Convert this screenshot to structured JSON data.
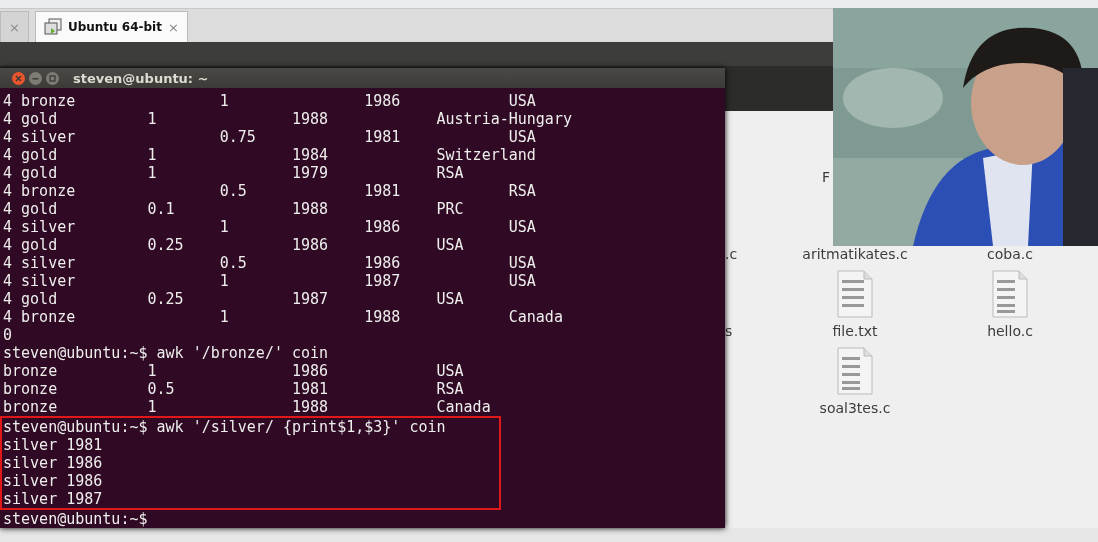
{
  "tabs": [
    {
      "close": "×",
      "selected": false
    },
    {
      "label": "Ubuntu 64-bit",
      "close": "×",
      "selected": true
    }
  ],
  "terminal": {
    "title": "steven@ubuntu: ~",
    "lines": [
      {
        "text": "4 bronze\t\t1\t\t1986\t\tUSA",
        "highlighted": false
      },
      {
        "text": "4 gold\t\t1\t\t1988\t\tAustria-Hungary",
        "highlighted": false
      },
      {
        "text": "4 silver\t\t0.75\t\t1981\t\tUSA",
        "highlighted": false
      },
      {
        "text": "4 gold\t\t1\t\t1984\t\tSwitzerland",
        "highlighted": false
      },
      {
        "text": "4 gold\t\t1\t\t1979\t\tRSA",
        "highlighted": false
      },
      {
        "text": "4 bronze\t\t0.5\t\t1981\t\tRSA",
        "highlighted": false
      },
      {
        "text": "4 gold\t\t0.1\t\t1988\t\tPRC",
        "highlighted": false
      },
      {
        "text": "4 silver\t\t1\t\t1986\t\tUSA",
        "highlighted": false
      },
      {
        "text": "4 gold\t\t0.25\t\t1986\t\tUSA",
        "highlighted": false
      },
      {
        "text": "4 silver\t\t0.5\t\t1986\t\tUSA",
        "highlighted": false
      },
      {
        "text": "4 silver\t\t1\t\t1987\t\tUSA",
        "highlighted": false
      },
      {
        "text": "4 gold\t\t0.25\t\t1987\t\tUSA",
        "highlighted": false
      },
      {
        "text": "4 bronze\t\t1\t\t1988\t\tCanada",
        "highlighted": false
      },
      {
        "text": "0",
        "highlighted": false
      },
      {
        "text": "steven@ubuntu:~$ awk '/bronze/' coin",
        "highlighted": false
      },
      {
        "text": "bronze\t\t1\t\t1986\t\tUSA",
        "highlighted": false
      },
      {
        "text": "bronze\t\t0.5\t\t1981\t\tRSA",
        "highlighted": false
      },
      {
        "text": "bronze\t\t1\t\t1988\t\tCanada",
        "highlighted": false
      },
      {
        "text": "steven@ubuntu:~$ awk '/silver/ {print$1,$3}' coin",
        "highlighted": true
      },
      {
        "text": "silver 1981",
        "highlighted": true
      },
      {
        "text": "silver 1986",
        "highlighted": true
      },
      {
        "text": "silver 1986",
        "highlighted": true
      },
      {
        "text": "silver 1987",
        "highlighted": true
      },
      {
        "text": "steven@ubuntu:~$",
        "highlighted": false
      }
    ]
  },
  "files": {
    "rows": [
      {
        "middle": {
          "name": "F",
          "kind": "label"
        }
      },
      {
        "left": ".c",
        "middle": {
          "name": "aritmatikates.c",
          "kind": "label"
        },
        "right": {
          "name": "coba.c",
          "kind": "label"
        }
      },
      {
        "left": "s",
        "middle": {
          "name": "file.txt",
          "kind": "text-file"
        },
        "right": {
          "name": "hello.c",
          "kind": "binary-file"
        }
      },
      {
        "middle": {
          "name": "soal3tes.c",
          "kind": "binary-file"
        }
      }
    ]
  }
}
